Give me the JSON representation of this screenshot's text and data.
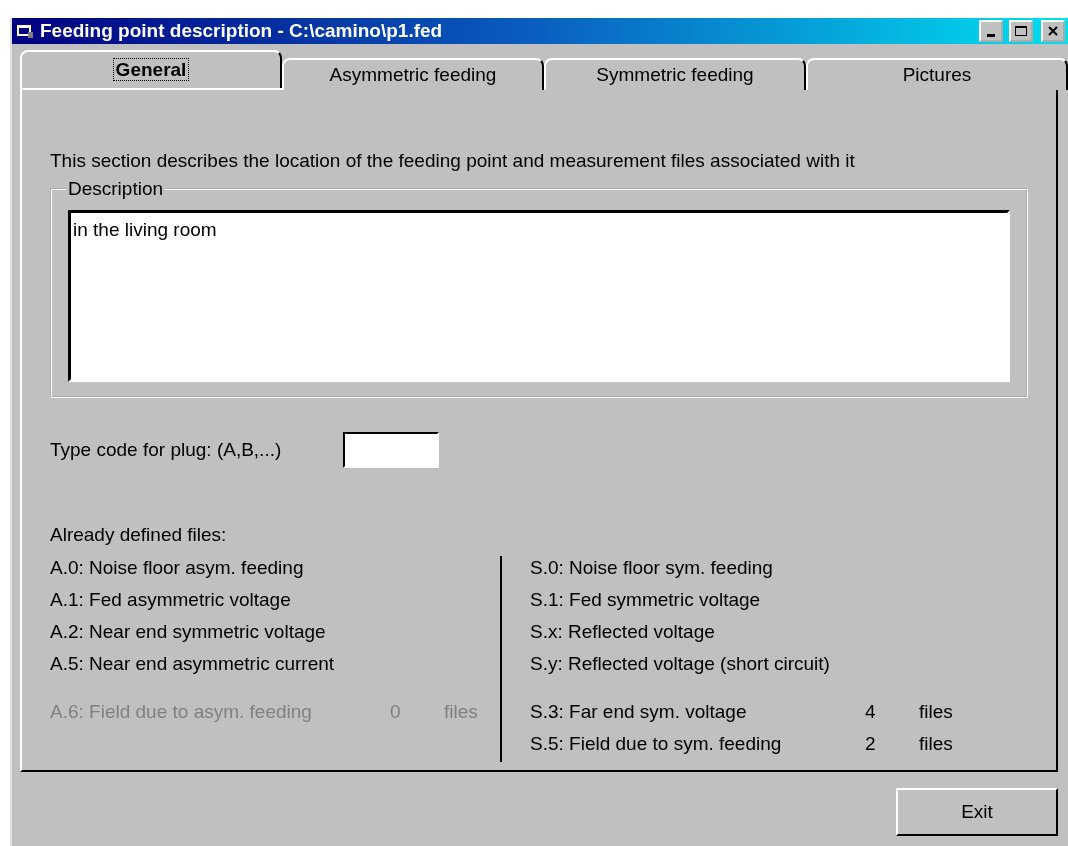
{
  "window": {
    "title": "Feeding point description - C:\\camino\\p1.fed"
  },
  "tabs": [
    {
      "label": "General",
      "selected": true
    },
    {
      "label": "Asymmetric feeding",
      "selected": false
    },
    {
      "label": "Symmetric feeding",
      "selected": false
    },
    {
      "label": "Pictures",
      "selected": false
    }
  ],
  "intro": "This section describes the location of the feeding point and measurement files associated with it",
  "description": {
    "legend": "Description",
    "value": "in the living room"
  },
  "plug": {
    "label": "Type code for plug: (A,B,...)"
  },
  "files": {
    "heading": "Already defined files:",
    "columns": [
      {
        "items": [
          "A.0: Noise floor asym. feeding",
          "A.1: Fed asymmetric voltage",
          "A.2: Near end symmetric voltage",
          "A.5: Near end asymmetric current"
        ],
        "counted": [
          {
            "label": "A.6: Field due to asym. feeding",
            "count": "0",
            "unit": "files",
            "disabled": true
          }
        ]
      },
      {
        "items": [
          "S.0: Noise floor sym. feeding",
          "S.1: Fed symmetric voltage",
          "S.x: Reflected voltage",
          "S.y: Reflected voltage (short circuit)"
        ],
        "counted": [
          {
            "label": "S.3: Far end sym. voltage",
            "count": "4",
            "unit": "files",
            "disabled": false
          },
          {
            "label": "S.5: Field due to sym. feeding",
            "count": "2",
            "unit": "files",
            "disabled": false
          }
        ]
      }
    ]
  },
  "buttons": [
    "Exit"
  ]
}
